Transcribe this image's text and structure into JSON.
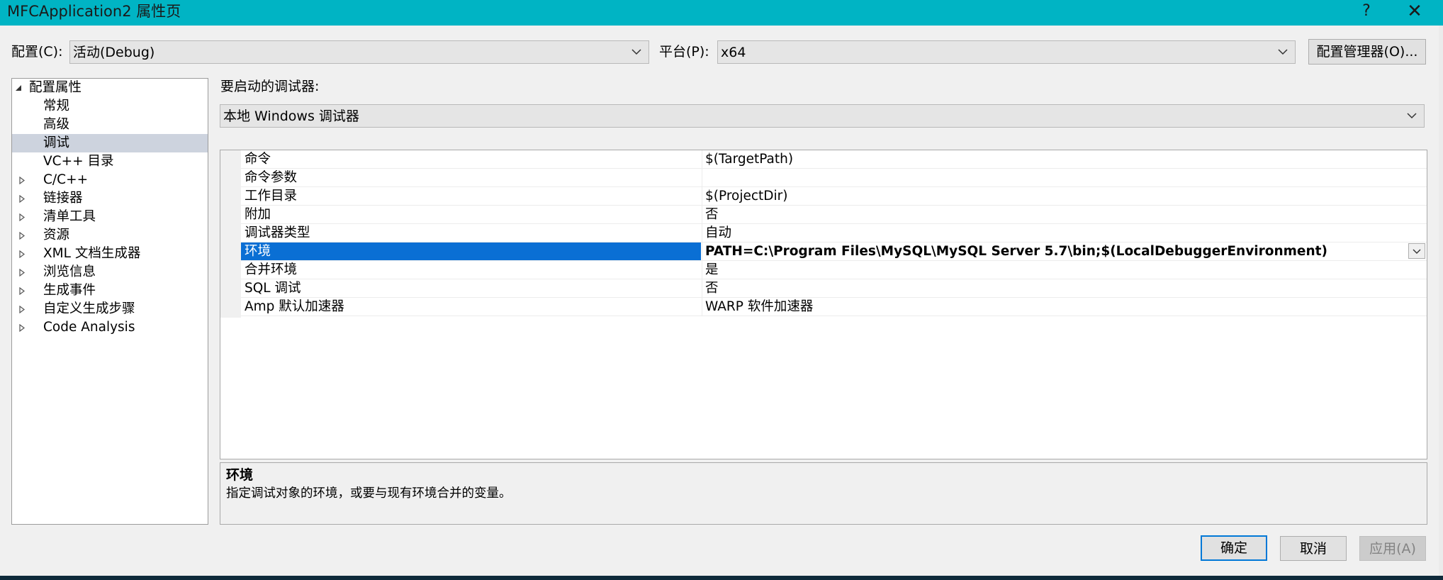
{
  "window": {
    "title": "MFCApplication2 属性页",
    "help_label": "?",
    "close_label": "✕"
  },
  "config": {
    "label": "配置(C):",
    "value": "活动(Debug)"
  },
  "platform": {
    "label": "平台(P):",
    "value": "x64"
  },
  "config_manager_label": "配置管理器(O)...",
  "tree": {
    "items": [
      {
        "label": "配置属性",
        "expander": "expanded"
      },
      {
        "label": "常规",
        "expander": "none"
      },
      {
        "label": "高级",
        "expander": "none"
      },
      {
        "label": "调试",
        "expander": "none",
        "selected": true
      },
      {
        "label": "VC++ 目录",
        "expander": "none"
      },
      {
        "label": "C/C++",
        "expander": "collapsed"
      },
      {
        "label": "链接器",
        "expander": "collapsed"
      },
      {
        "label": "清单工具",
        "expander": "collapsed"
      },
      {
        "label": "资源",
        "expander": "collapsed"
      },
      {
        "label": "XML 文档生成器",
        "expander": "collapsed"
      },
      {
        "label": "浏览信息",
        "expander": "collapsed"
      },
      {
        "label": "生成事件",
        "expander": "collapsed"
      },
      {
        "label": "自定义生成步骤",
        "expander": "collapsed"
      },
      {
        "label": "Code Analysis",
        "expander": "collapsed"
      }
    ]
  },
  "debugger": {
    "label": "要启动的调试器:",
    "value": "本地 Windows 调试器"
  },
  "properties": {
    "rows": [
      {
        "name": "命令",
        "value": "$(TargetPath)"
      },
      {
        "name": "命令参数",
        "value": ""
      },
      {
        "name": "工作目录",
        "value": "$(ProjectDir)"
      },
      {
        "name": "附加",
        "value": "否"
      },
      {
        "name": "调试器类型",
        "value": "自动"
      },
      {
        "name": "环境",
        "value": "PATH=C:\\Program Files\\MySQL\\MySQL Server 5.7\\bin;$(LocalDebuggerEnvironment)",
        "selected": true
      },
      {
        "name": "合并环境",
        "value": "是"
      },
      {
        "name": "SQL 调试",
        "value": "否"
      },
      {
        "name": "Amp 默认加速器",
        "value": "WARP 软件加速器"
      }
    ]
  },
  "description": {
    "title": "环境",
    "text": "指定调试对象的环境，或要与现有环境合并的变量。"
  },
  "buttons": {
    "ok": "确定",
    "cancel": "取消",
    "apply": "应用(A)"
  },
  "colors": {
    "titlebar": "#00b4c4",
    "selection": "#0a6fd4",
    "tree_selection": "#cdd3de"
  }
}
